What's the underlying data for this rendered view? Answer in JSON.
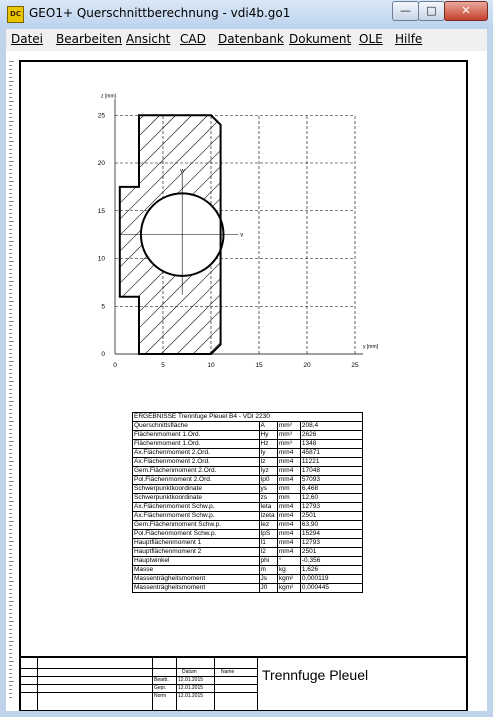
{
  "window": {
    "app_icon_text": "DC",
    "title": "GEO1+  Querschnittberechnung  -  vdi4b.go1",
    "minimize": "—",
    "maximize": "□",
    "close": "✕"
  },
  "menu": [
    "Datei",
    "Bearbeiten",
    "Ansicht",
    "CAD",
    "Datenbank",
    "Dokument",
    "OLE",
    "Hilfe"
  ],
  "chart_data": {
    "type": "line",
    "xlabel": "y [mm]",
    "ylabel": "z [mm]",
    "x_ticks": [
      "0",
      "5",
      "10",
      "15",
      "20",
      "25"
    ],
    "y_ticks": [
      "0",
      "5",
      "10",
      "15",
      "20",
      "25"
    ],
    "xlim": [
      0,
      25
    ],
    "ylim": [
      0,
      25
    ],
    "grid": true,
    "axis_labels": {
      "v": "v",
      "w": "w"
    },
    "outline": [
      [
        2.5,
        0
      ],
      [
        10,
        0
      ],
      [
        11,
        1
      ],
      [
        11,
        24
      ],
      [
        10,
        25
      ],
      [
        2.5,
        25
      ],
      [
        2.5,
        17.5
      ],
      [
        0.5,
        17.5
      ],
      [
        0.5,
        6
      ],
      [
        2.5,
        6
      ],
      [
        2.5,
        0
      ]
    ],
    "hole": {
      "cx": 7,
      "cy": 12.5,
      "r": 4.3
    }
  },
  "results": {
    "header": "ERGEBNISSE  Trennfuge Pleuel B4 - VDI 2230",
    "rows": [
      [
        "Querschnittsfläche",
        "A",
        "mm²",
        "208,4"
      ],
      [
        "Flächenmoment 1.Ord.",
        "Hy",
        "mm³",
        "2626"
      ],
      [
        "Flächenmoment 1.Ord.",
        "Hz",
        "mm³",
        "1348"
      ],
      [
        "Ax.Flächenmoment 2.Ord.",
        "Iy",
        "mm4",
        "45871"
      ],
      [
        "Ax.Flächenmoment 2.Ord.",
        "Iz",
        "mm4",
        "11221"
      ],
      [
        "Gem.Flächenmoment 2.Ord.",
        "Iyz",
        "mm4",
        "17048"
      ],
      [
        "Pol.Flächenmoment 2.Ord.",
        "Ip0",
        "mm4",
        "57093"
      ],
      [
        "Schwerpunktkoordinate",
        "ys",
        "mm",
        "6,468"
      ],
      [
        "Schwerpunktkoordinate",
        "zs",
        "mm",
        "12,60"
      ],
      [
        "Ax.Flächenmoment Schw.p.",
        "Ieta",
        "mm4",
        "12793"
      ],
      [
        "Ax.Flächenmoment Schw.p.",
        "Izeta",
        "mm4",
        "2501"
      ],
      [
        "Gem.Flächenmoment Schw.p.",
        "Iez",
        "mm4",
        "63,90"
      ],
      [
        "Pol.Flächenmoment Schw.p.",
        "IpS",
        "mm4",
        "15294"
      ],
      [
        "Hauptflächenmoment 1",
        "I1",
        "mm4",
        "12793"
      ],
      [
        "Hauptflächenmoment 2",
        "I2",
        "mm4",
        "2501"
      ],
      [
        "Hauptwinkel",
        "phi",
        "°",
        "-0,356"
      ],
      [
        "Masse",
        "m",
        "kg",
        "1,626"
      ],
      [
        "Massenträgheitsmoment",
        "Js",
        "kgm²",
        "0,000119"
      ],
      [
        "Massenträgheitsmoment",
        "J0",
        "kgm²",
        "0,000445"
      ]
    ]
  },
  "titleblock": {
    "datum": "Datum",
    "name": "Name",
    "rows": [
      {
        "label": "Bearb.",
        "date": "12.01.2015"
      },
      {
        "label": "Gepr.",
        "date": "12.01.2015"
      },
      {
        "label": "Norm",
        "date": "12.01.2015"
      }
    ],
    "title": "Trennfuge Pleuel"
  }
}
